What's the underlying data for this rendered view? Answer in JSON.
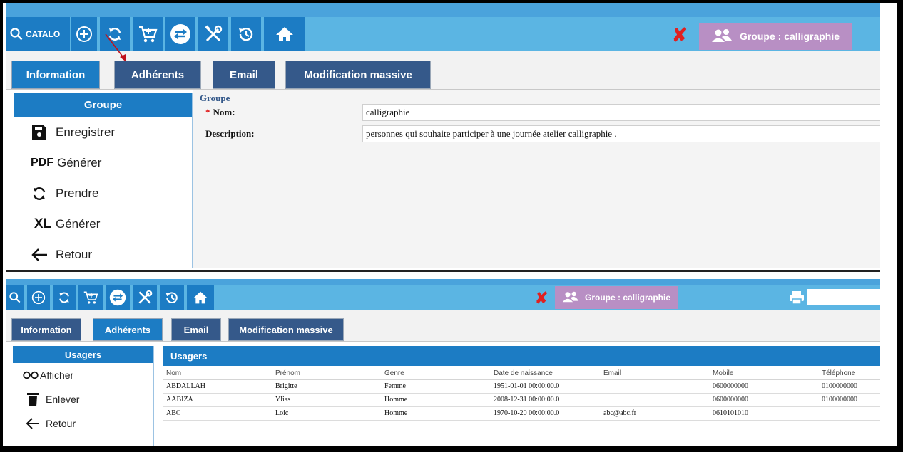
{
  "colors": {
    "toolbar_dark": "#1c7cc4",
    "toolbar_light": "#5bb5e3",
    "tab_inactive": "#35598a",
    "badge": "#b88fc4",
    "close_red": "#e02020"
  },
  "panel1": {
    "toolbar": {
      "catalog_label": "CATALO",
      "icons": [
        "search-icon",
        "add-circle-icon",
        "refresh-icon",
        "cart-icon",
        "swap-icon",
        "tools-icon",
        "history-icon",
        "home-icon"
      ],
      "close_icon": "red-x-icon",
      "group_badge": "Groupe : calligraphie"
    },
    "tabs": [
      "Information",
      "Adhérents",
      "Email",
      "Modification massive"
    ],
    "sidebar": {
      "header": "Groupe",
      "items": [
        {
          "icon_text": "",
          "label": "Enregistrer",
          "icon": "save-icon"
        },
        {
          "icon_text": "PDF",
          "label": "Générer",
          "icon": "pdf-icon"
        },
        {
          "icon_text": "",
          "label": "Prendre",
          "icon": "refresh-icon"
        },
        {
          "icon_text": "XL",
          "label": "Générer",
          "icon": "excel-icon"
        },
        {
          "icon_text": "",
          "label": "Retour",
          "icon": "back-arrow-icon"
        }
      ]
    },
    "form": {
      "group_label": "Groupe",
      "required_mark": "*",
      "nom_label": "Nom:",
      "nom_value": "calligraphie",
      "description_label": "Description:",
      "description_value": "personnes qui souhaite participer à une journée atelier calligraphie ."
    }
  },
  "panel2": {
    "toolbar": {
      "icons": [
        "search-icon",
        "add-circle-icon",
        "refresh-icon",
        "cart-icon",
        "swap-icon",
        "tools-icon",
        "history-icon",
        "home-icon"
      ],
      "close_icon": "red-x-icon",
      "group_badge": "Groupe : calligraphie",
      "print_icon": "printer-icon"
    },
    "tabs": [
      "Information",
      "Adhérents",
      "Email",
      "Modification massive"
    ],
    "sidebar": {
      "header": "Usagers",
      "items": [
        {
          "label": "Afficher",
          "icon": "glasses-icon"
        },
        {
          "label": "Enlever",
          "icon": "trash-icon"
        },
        {
          "label": "Retour",
          "icon": "back-arrow-icon"
        }
      ]
    },
    "table": {
      "title": "Usagers",
      "columns": [
        "Nom",
        "Prénom",
        "Genre",
        "Date de naissance",
        "Email",
        "Mobile",
        "Téléphone"
      ],
      "rows": [
        [
          "ABDALLAH",
          "Brigitte",
          "Femme",
          "1951-01-01 00:00:00.0",
          "",
          "0600000000",
          "0100000000"
        ],
        [
          "AABIZA",
          "Ylias",
          "Homme",
          "2008-12-31 00:00:00.0",
          "",
          "0600000000",
          "0100000000"
        ],
        [
          "ABC",
          "Loic",
          "Homme",
          "1970-10-20 00:00:00.0",
          "abc@abc.fr",
          "0610101010",
          ""
        ]
      ]
    }
  }
}
